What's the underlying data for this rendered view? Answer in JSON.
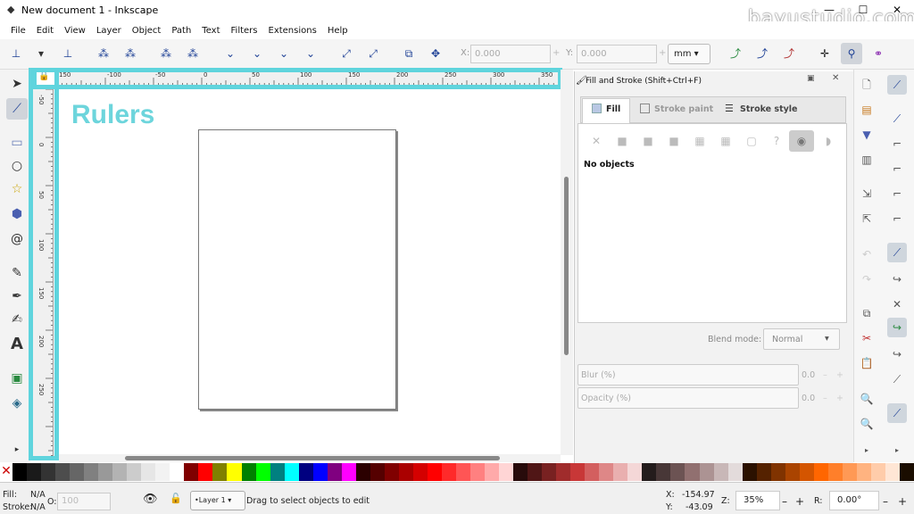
{
  "window": {
    "title": "New document 1 - Inkscape",
    "watermark": "bayustudio.com",
    "minimize": "—",
    "maximize": "☐",
    "close": "✕"
  },
  "menu": [
    "File",
    "Edit",
    "View",
    "Layer",
    "Object",
    "Path",
    "Text",
    "Filters",
    "Extensions",
    "Help"
  ],
  "toolbar": {
    "x_label": "X:",
    "x_value": "0.000",
    "y_label": "Y:",
    "y_value": "0.000",
    "unit": "mm",
    "minus": "–",
    "plus": "+"
  },
  "ruler_h_ticks": [
    "150",
    "-100",
    "-50",
    "0",
    "50",
    "100",
    "150",
    "200",
    "250",
    "300",
    "350"
  ],
  "ruler_v_ticks": [
    "-50",
    "0",
    "50",
    "100",
    "150",
    "200",
    "250"
  ],
  "canvas": {
    "annotation": "Rulers"
  },
  "fill_stroke": {
    "title": "Fill and Stroke (Shift+Ctrl+F)",
    "tabs": [
      "Fill",
      "Stroke paint",
      "Stroke style"
    ],
    "no_objects": "No objects",
    "blend_label": "Blend mode:",
    "blend_value": "Normal",
    "blur_label": "Blur (%)",
    "blur_value": "0.0",
    "opacity_label": "Opacity (%)",
    "opacity_value": "0.0"
  },
  "status": {
    "fill_label": "Fill:",
    "fill_value": "N/A",
    "stroke_label": "Stroke:",
    "stroke_value": "N/A",
    "o_label": "O:",
    "o_value": "100",
    "layer": "•Layer 1",
    "message": "Drag to select objects to edit",
    "x_label": "X:",
    "x_value": "-154.97",
    "y_label": "Y:",
    "y_value": "-43.09",
    "z_label": "Z:",
    "zoom": "35%",
    "r_label": "R:",
    "rotation": "0.00°"
  },
  "colors": {
    "highlight": "#5fd4dd",
    "accent": "#1c3f95"
  },
  "palette": [
    "#000000",
    "#1a1a1a",
    "#333333",
    "#4d4d4d",
    "#666666",
    "#808080",
    "#999999",
    "#b3b3b3",
    "#cccccc",
    "#e6e6e6",
    "#f2f2f2",
    "#ffffff",
    "#800000",
    "#ff0000",
    "#808000",
    "#ffff00",
    "#008000",
    "#00ff00",
    "#008080",
    "#00ffff",
    "#000080",
    "#0000ff",
    "#800080",
    "#ff00ff",
    "#2b0000",
    "#550000",
    "#800000",
    "#aa0000",
    "#d40000",
    "#ff0000",
    "#ff2a2a",
    "#ff5555",
    "#ff8080",
    "#ffaaaa",
    "#ffd5d5",
    "#280b0b",
    "#501616",
    "#782121",
    "#a02c2c",
    "#c83737",
    "#d35f5f",
    "#de8787",
    "#e9afaf",
    "#f4d7d7",
    "#241c1c",
    "#483737",
    "#6c5353",
    "#917070",
    "#ac9393",
    "#c8b7b7",
    "#e3dbdb",
    "#2b1100",
    "#552200",
    "#803300",
    "#aa4400",
    "#d45500",
    "#ff6600",
    "#ff7f2a",
    "#ff9955",
    "#ffb380",
    "#ffccaa",
    "#ffe6d5",
    "#1a0d00"
  ]
}
